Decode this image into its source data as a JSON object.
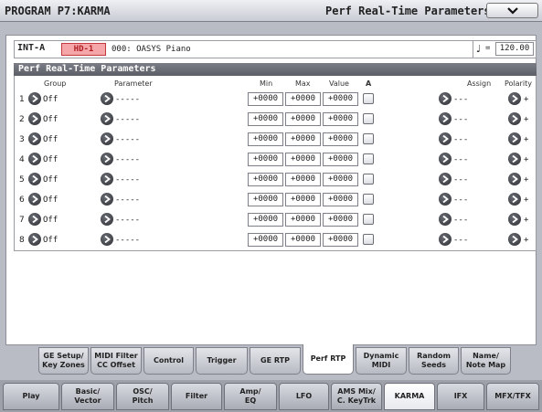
{
  "header": {
    "title": "PROGRAM P7:KARMA",
    "page_name": "Perf Real-Time Parameters"
  },
  "program": {
    "bank": "INT-A",
    "bank_tag": "HD-1",
    "name": "000: OASYS Piano",
    "tempo_symbol": "♩",
    "tempo_equals": "=",
    "tempo": "120.00"
  },
  "section": {
    "title": "Perf Real-Time Parameters",
    "columns": {
      "group": "Group",
      "parameter": "Parameter",
      "min": "Min",
      "max": "Max",
      "value": "Value",
      "a": "A",
      "assign": "Assign",
      "polarity": "Polarity"
    },
    "rows": [
      {
        "num": "1",
        "group": "Off",
        "parameter": "-----",
        "min": "+0000",
        "max": "+0000",
        "value": "+0000",
        "assign": "---",
        "polarity": "+"
      },
      {
        "num": "2",
        "group": "Off",
        "parameter": "-----",
        "min": "+0000",
        "max": "+0000",
        "value": "+0000",
        "assign": "---",
        "polarity": "+"
      },
      {
        "num": "3",
        "group": "Off",
        "parameter": "-----",
        "min": "+0000",
        "max": "+0000",
        "value": "+0000",
        "assign": "---",
        "polarity": "+"
      },
      {
        "num": "4",
        "group": "Off",
        "parameter": "-----",
        "min": "+0000",
        "max": "+0000",
        "value": "+0000",
        "assign": "---",
        "polarity": "+"
      },
      {
        "num": "5",
        "group": "Off",
        "parameter": "-----",
        "min": "+0000",
        "max": "+0000",
        "value": "+0000",
        "assign": "---",
        "polarity": "+"
      },
      {
        "num": "6",
        "group": "Off",
        "parameter": "-----",
        "min": "+0000",
        "max": "+0000",
        "value": "+0000",
        "assign": "---",
        "polarity": "+"
      },
      {
        "num": "7",
        "group": "Off",
        "parameter": "-----",
        "min": "+0000",
        "max": "+0000",
        "value": "+0000",
        "assign": "---",
        "polarity": "+"
      },
      {
        "num": "8",
        "group": "Off",
        "parameter": "-----",
        "min": "+0000",
        "max": "+0000",
        "value": "+0000",
        "assign": "---",
        "polarity": "+"
      }
    ]
  },
  "subtabs": [
    {
      "label": "GE Setup/\nKey Zones"
    },
    {
      "label": "MIDI Filter\nCC Offset"
    },
    {
      "label": "Control"
    },
    {
      "label": "Trigger"
    },
    {
      "label": "GE RTP"
    },
    {
      "label": "Perf RTP",
      "active": true
    },
    {
      "label": "Dynamic\nMIDI"
    },
    {
      "label": "Random\nSeeds"
    },
    {
      "label": "Name/\nNote Map"
    }
  ],
  "maintabs": [
    {
      "label": "Play"
    },
    {
      "label": "Basic/\nVector"
    },
    {
      "label": "OSC/\nPitch"
    },
    {
      "label": "Filter"
    },
    {
      "label": "Amp/\nEQ"
    },
    {
      "label": "LFO"
    },
    {
      "label": "AMS Mix/\nC. KeyTrk"
    },
    {
      "label": "KARMA",
      "active": true
    },
    {
      "label": "IFX"
    },
    {
      "label": "MFX/TFX"
    }
  ],
  "icons": {
    "row_arrow": "chevron-right-icon",
    "page_menu": "chevron-down-icon"
  }
}
